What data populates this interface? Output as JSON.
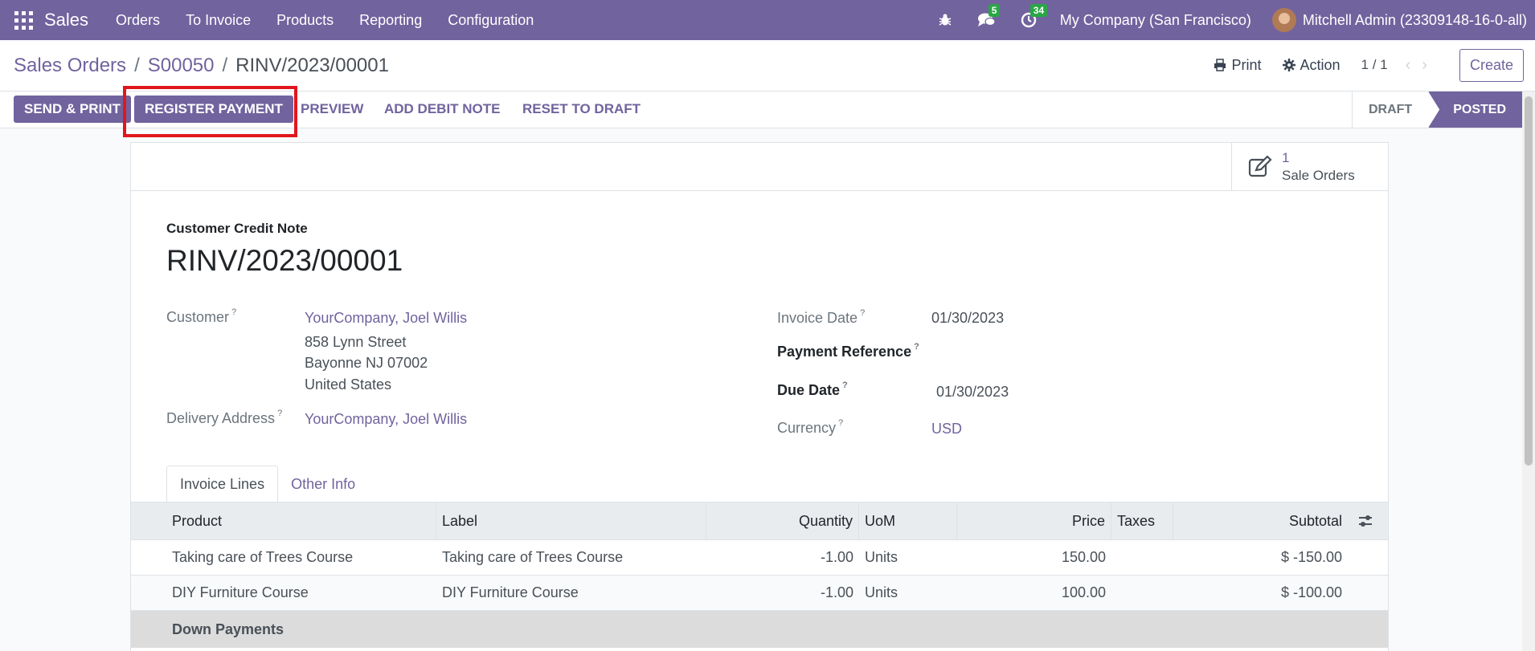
{
  "navbar": {
    "app_name": "Sales",
    "menu": [
      "Orders",
      "To Invoice",
      "Products",
      "Reporting",
      "Configuration"
    ],
    "messages_count": "5",
    "activities_count": "34",
    "company": "My Company (San Francisco)",
    "user": "Mitchell Admin (23309148-16-0-all)",
    "bar_color": "#71639e"
  },
  "breadcrumb": {
    "items": [
      "Sales Orders",
      "S00050"
    ],
    "current": "RINV/2023/00001"
  },
  "control": {
    "print_label": "Print",
    "action_label": "Action",
    "pager": "1 / 1",
    "create_label": "Create"
  },
  "actions": {
    "send_print": "Send & Print",
    "register_payment": "Register Payment",
    "preview": "Preview",
    "add_debit_note": "Add Debit Note",
    "reset_to_draft": "Reset to Draft"
  },
  "stages": {
    "draft": "DRAFT",
    "posted": "POSTED",
    "current": "posted"
  },
  "smart_button": {
    "value": "1",
    "label": "Sale Orders"
  },
  "document": {
    "type": "Customer Credit Note",
    "name": "RINV/2023/00001"
  },
  "fields": {
    "customer_label": "Customer",
    "customer_name": "YourCompany, Joel Willis",
    "customer_address": [
      "858 Lynn Street",
      "Bayonne NJ 07002",
      "United States"
    ],
    "delivery_label": "Delivery Address",
    "delivery_value": "YourCompany, Joel Willis",
    "invoice_date_label": "Invoice Date",
    "invoice_date": "01/30/2023",
    "payment_ref_label": "Payment Reference",
    "due_date_label": "Due Date",
    "due_date": "01/30/2023",
    "currency_label": "Currency",
    "currency": "USD"
  },
  "tabs": [
    "Invoice Lines",
    "Other Info"
  ],
  "table": {
    "headers": {
      "product": "Product",
      "label": "Label",
      "quantity": "Quantity",
      "uom": "UoM",
      "price": "Price",
      "taxes": "Taxes",
      "subtotal": "Subtotal"
    },
    "rows": [
      {
        "product": "Taking care of Trees Course",
        "label": "Taking care of Trees Course",
        "quantity": "-1.00",
        "uom": "Units",
        "price": "150.00",
        "taxes": "",
        "subtotal": "$ -150.00"
      },
      {
        "product": "DIY Furniture Course",
        "label": "DIY Furniture Course",
        "quantity": "-1.00",
        "uom": "Units",
        "price": "100.00",
        "taxes": "",
        "subtotal": "$ -100.00"
      }
    ],
    "section": "Down Payments"
  },
  "highlight_color": "#e1161d"
}
